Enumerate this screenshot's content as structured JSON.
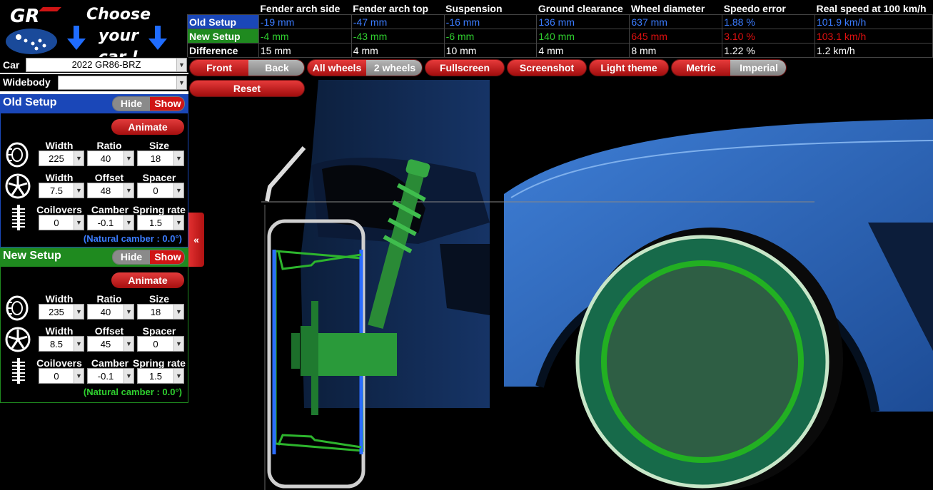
{
  "header": {
    "logo_text": "GR",
    "title_line1": "Choose your",
    "title_line2": "car !"
  },
  "comparison": {
    "columns": [
      "Fender arch side",
      "Fender arch top",
      "Suspension",
      "Ground clearance",
      "Wheel diameter",
      "Speedo error",
      "Real speed at 100 km/h"
    ],
    "rows": [
      {
        "label": "Old Setup",
        "values": [
          "-19 mm",
          "-47 mm",
          "-16 mm",
          "136 mm",
          "637 mm",
          "1.88 %",
          "101.9 km/h"
        ]
      },
      {
        "label": "New Setup",
        "values": [
          "-4 mm",
          "-43 mm",
          "-6 mm",
          "140 mm",
          "645 mm",
          "3.10 %",
          "103.1 km/h"
        ]
      },
      {
        "label": "Difference",
        "values": [
          "15 mm",
          "4 mm",
          "10 mm",
          "4 mm",
          "8 mm",
          "1.22 %",
          "1.2 km/h"
        ]
      }
    ]
  },
  "car_select": {
    "label": "Car",
    "value": "2022 GR86-BRZ"
  },
  "widebody_select": {
    "label": "Widebody",
    "value": ""
  },
  "old_setup": {
    "title": "Old Setup",
    "hide": "Hide",
    "show": "Show",
    "animate": "Animate",
    "tire": {
      "width_label": "Width",
      "ratio_label": "Ratio",
      "size_label": "Size",
      "width": "225",
      "ratio": "40",
      "size": "18"
    },
    "wheel": {
      "width_label": "Width",
      "offset_label": "Offset",
      "spacer_label": "Spacer",
      "width": "7.5",
      "offset": "48",
      "spacer": "0"
    },
    "susp": {
      "coilovers_label": "Coilovers",
      "camber_label": "Camber",
      "spring_label": "Spring rate",
      "coilovers": "0",
      "camber": "-0.1",
      "spring": "1.5"
    },
    "natural_camber": "(Natural camber : 0.0°)"
  },
  "new_setup": {
    "title": "New Setup",
    "hide": "Hide",
    "show": "Show",
    "animate": "Animate",
    "tire": {
      "width_label": "Width",
      "ratio_label": "Ratio",
      "size_label": "Size",
      "width": "235",
      "ratio": "40",
      "size": "18"
    },
    "wheel": {
      "width_label": "Width",
      "offset_label": "Offset",
      "spacer_label": "Spacer",
      "width": "8.5",
      "offset": "45",
      "spacer": "0"
    },
    "susp": {
      "coilovers_label": "Coilovers",
      "camber_label": "Camber",
      "spring_label": "Spring rate",
      "coilovers": "0",
      "camber": "-0.1",
      "spring": "1.5"
    },
    "natural_camber": "(Natural camber : 0.0°)"
  },
  "collapse_tab": "«",
  "toolbar": {
    "front": "Front",
    "back": "Back",
    "all_wheels": "All wheels",
    "two_wheels": "2 wheels",
    "fullscreen": "Fullscreen",
    "screenshot": "Screenshot",
    "light_theme": "Light theme",
    "metric": "Metric",
    "imperial": "Imperial",
    "reset": "Reset"
  },
  "colors": {
    "old": "#1a47b8",
    "new": "#1f8a1f",
    "accent_red": "#d01515",
    "wheel_green": "#2fb52f"
  },
  "icons": [
    "tire-icon",
    "rim-icon",
    "coilover-icon",
    "dropdown-arrow-icon",
    "arrow-down-icon"
  ]
}
